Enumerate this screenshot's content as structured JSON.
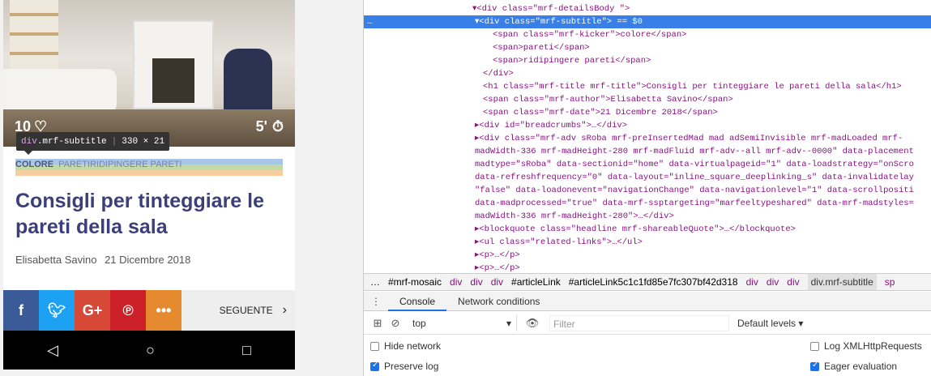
{
  "article": {
    "likes": "10",
    "minutes": "5'",
    "tooltip_tag": "div",
    "tooltip_class": ".mrf-subtitle",
    "tooltip_size": "330 × 21",
    "kicker": "COLORE",
    "subtitle_parts": [
      "PARETI",
      "RIDIPINGERE PARETI"
    ],
    "title": "Consigli per tinteggiare le pareti della sala",
    "author": "Elisabetta Savino",
    "date": "21 Dicembre 2018",
    "share_next": "SEGUENTE"
  },
  "devtools": {
    "lines": [
      {
        "indent": 0,
        "text": "▾<div class=\"mrf-detailsBody \">"
      },
      {
        "indent": 1,
        "text": "▾<div class=\"mrf-subtitle\"> == $0",
        "selected": true
      },
      {
        "indent": 2,
        "text": "<span class=\"mrf-kicker\">colore</span>"
      },
      {
        "indent": 2,
        "text": "<span>pareti</span>"
      },
      {
        "indent": 2,
        "text": "<span>ridipingere pareti</span>"
      },
      {
        "indent": 1,
        "text": "</div>"
      },
      {
        "indent": 1,
        "text": "<h1 class=\"mrf-title mrf-title\">Consigli per tinteggiare le pareti della sala</h1>"
      },
      {
        "indent": 1,
        "text": "<span class=\"mrf-author\">Elisabetta Savino</span>"
      },
      {
        "indent": 1,
        "text": "<span class=\"mrf-date\">21 Dicembre 2018</span>"
      },
      {
        "indent": 0,
        "text": "▸<div id=\"breadcrumbs\">…</div>"
      },
      {
        "indent": 0,
        "text": "▸<div class=\"mrf-adv sRoba mrf-preInsertedMad mad adSemiInvisible mrf-madLoaded mrf-"
      },
      {
        "indent": 0,
        "text": "madWidth-336 mrf-madHeight-280 mrf-madFluid mrf-adv--all mrf-adv--0000\" data-placement"
      },
      {
        "indent": 0,
        "text": "madtype=\"sRoba\" data-sectionid=\"home\" data-virtualpageid=\"1\" data-loadstrategy=\"onScro"
      },
      {
        "indent": 0,
        "text": "data-refreshfrequency=\"0\" data-layout=\"inline_square_deeplinking_s\" data-invalidatelay"
      },
      {
        "indent": 0,
        "text": "\"false\" data-loadonevent=\"navigationChange\" data-navigationlevel=\"1\" data-scrollpositi"
      },
      {
        "indent": 0,
        "text": "data-madprocessed=\"true\" data-mrf-ssptargeting=\"marfeeltypeshared\" data-mrf-madstyles="
      },
      {
        "indent": 0,
        "text": "madWidth-336 mrf-madHeight-280\">…</div>"
      },
      {
        "indent": 0,
        "text": "▸<blockquote class=\"headline mrf-shareableQuote\">…</blockquote>"
      },
      {
        "indent": 0,
        "text": "▸<ul class=\"related-links\">…</ul>"
      },
      {
        "indent": 0,
        "text": "▸<p>…</p>"
      },
      {
        "indent": 0,
        "text": "▸<p>…</p>"
      }
    ],
    "breadcrumbs": [
      "…",
      "#mrf-mosaic",
      "div",
      "div",
      "div",
      "#articleLink",
      "#articleLink5c1c1fd85e7fc307bf42d318",
      "div",
      "div",
      "div",
      "div.mrf-subtitle",
      "sp"
    ],
    "tabs": [
      "Console",
      "Network conditions"
    ],
    "context": "top",
    "filter_placeholder": "Filter",
    "levels": "Default levels ▾",
    "options": {
      "hide_network": "Hide network",
      "preserve_log": "Preserve log",
      "log_xhr": "Log XMLHttpRequests",
      "eager_eval": "Eager evaluation"
    }
  }
}
